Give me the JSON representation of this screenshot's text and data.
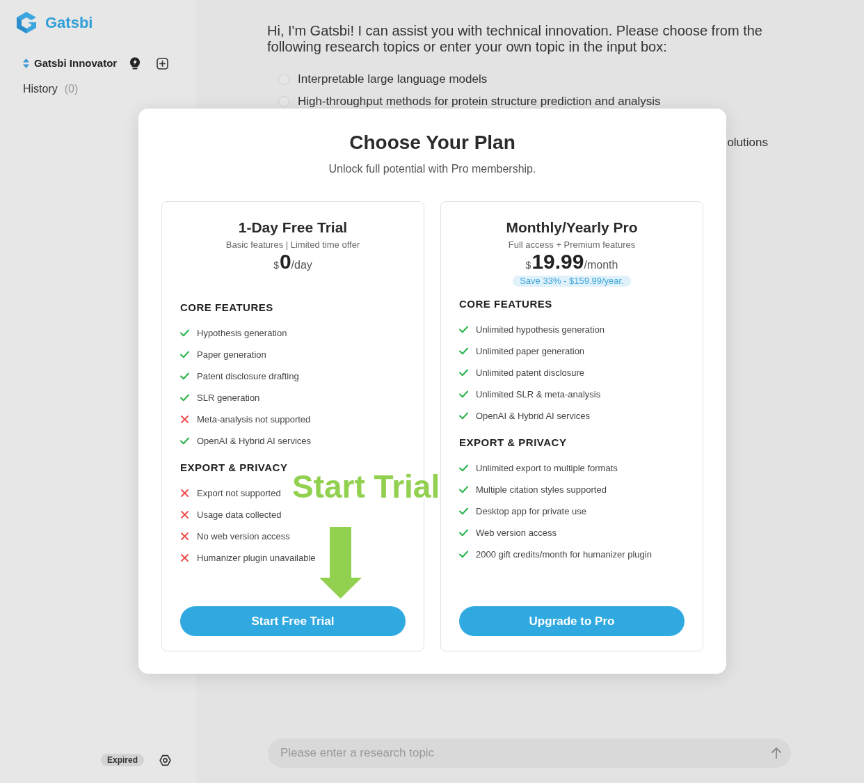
{
  "sidebar": {
    "brand": "Gatsbi",
    "assistant": "Gatsbi Innovator",
    "history": {
      "label": "History",
      "count": "(0)"
    },
    "status_badge": "Expired"
  },
  "chat": {
    "message": "Hi, I'm Gatsbi! I can assist you with technical innovation. Please choose from the following research topics or enter your own topic in the input box:",
    "options": [
      {
        "text": "Interpretable large language models",
        "selected": false
      },
      {
        "text": "High-throughput methods for protein structure prediction and analysis",
        "selected": false
      }
    ],
    "option_tail": "olutions",
    "input": {
      "placeholder": "Please enter a research topic"
    }
  },
  "modal": {
    "title": "Choose Your Plan",
    "subtitle": "Unlock full potential with Pro membership.",
    "plans": [
      {
        "name": "1-Day Free Trial",
        "tagline": "Basic features | Limited time offer",
        "price": {
          "currency": "$",
          "amount": "0",
          "period": "/day"
        },
        "sections": [
          {
            "heading": "CORE FEATURES",
            "features": [
              {
                "text": "Hypothesis generation",
                "included": true
              },
              {
                "text": "Paper generation",
                "included": true
              },
              {
                "text": "Patent disclosure drafting",
                "included": true
              },
              {
                "text": "SLR generation",
                "included": true
              },
              {
                "text": "Meta-analysis not supported",
                "included": false
              },
              {
                "text": "OpenAI & Hybrid AI services",
                "included": true
              }
            ]
          },
          {
            "heading": "EXPORT & PRIVACY",
            "features": [
              {
                "text": "Export not supported",
                "included": false
              },
              {
                "text": "Usage data collected",
                "included": false
              },
              {
                "text": "No web version access",
                "included": false
              },
              {
                "text": "Humanizer plugin unavailable",
                "included": false
              }
            ]
          }
        ],
        "button": "Start Free Trial"
      },
      {
        "name": "Monthly/Yearly Pro",
        "tagline": "Full access + Premium features",
        "price": {
          "currency": "$",
          "amount": "19.99",
          "period": "/month"
        },
        "savings": "Save 33% - $159.99/year.",
        "sections": [
          {
            "heading": "CORE FEATURES",
            "features": [
              {
                "text": "Unlimited hypothesis generation",
                "included": true
              },
              {
                "text": "Unlimited paper generation",
                "included": true
              },
              {
                "text": "Unlimited patent disclosure",
                "included": true
              },
              {
                "text": "Unlimited SLR & meta-analysis",
                "included": true
              },
              {
                "text": "OpenAI & Hybrid AI services",
                "included": true
              }
            ]
          },
          {
            "heading": "EXPORT & PRIVACY",
            "features": [
              {
                "text": "Unlimited export to multiple formats",
                "included": true
              },
              {
                "text": "Multiple citation styles supported",
                "included": true
              },
              {
                "text": "Desktop app for private use",
                "included": true
              },
              {
                "text": "Web version access",
                "included": true
              },
              {
                "text": "2000 gift credits/month for humanizer plugin",
                "included": true
              }
            ]
          }
        ],
        "button": "Upgrade to Pro"
      }
    ]
  },
  "annotation": {
    "text": "Start Trial"
  }
}
